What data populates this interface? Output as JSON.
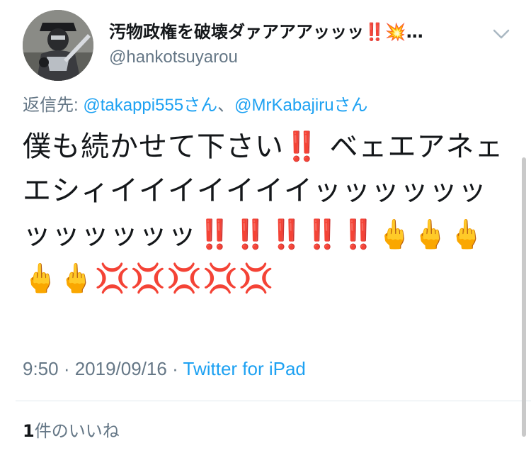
{
  "author": {
    "display_name": "汚物政権を破壊ダァアアアッッッ‼️💥…",
    "handle": "@hankotsuyarou"
  },
  "reply": {
    "label": "返信先: ",
    "mention_1": "@takappi555さん",
    "separator": "、",
    "mention_2": "@MrKabajiruさん"
  },
  "tweet": {
    "text": "僕も続かせて下さい‼️ ベェエアネェエシィイイイイイイイッッッッッッッッッッッッ‼️‼️‼️‼️‼️🖕🖕🖕🖕🖕💢💢💢💢💢"
  },
  "meta": {
    "time": "9:50",
    "dot_1": " · ",
    "date": "2019/09/16",
    "dot_2": " · ",
    "source": "Twitter for iPad"
  },
  "likes": {
    "count": "1",
    "label": "件のいいね"
  },
  "icons": {
    "menu": "chevron-down-icon",
    "avatar": "profile-avatar"
  },
  "colors": {
    "link": "#1da1f2",
    "secondary_text": "#657786",
    "divider": "#e1e8ed"
  }
}
